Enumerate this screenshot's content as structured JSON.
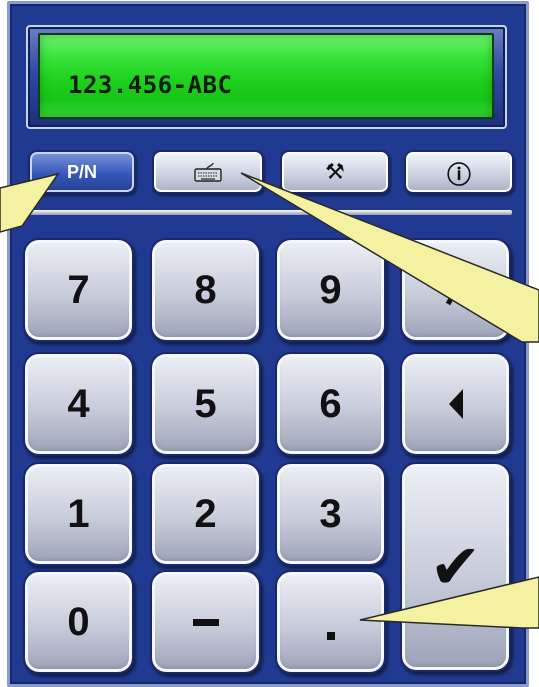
{
  "display": {
    "value": "123.456-ABC"
  },
  "toolbar": {
    "mode_label": "P/N",
    "keyboard_icon": "keyboard-icon",
    "tools_label": "⚒",
    "info_label": "ⓘ"
  },
  "keypad": {
    "k7": "7",
    "k8": "8",
    "k9": "9",
    "k4": "4",
    "k5": "5",
    "k6": "6",
    "k1": "1",
    "k2": "2",
    "k3": "3",
    "k0": "0",
    "minus": "−",
    "dot": ".",
    "enter": "✔"
  },
  "colors": {
    "frame": "#213a91",
    "display": "#1fd11f",
    "active_button": "#3657b9",
    "callout": "#f4f1a0"
  }
}
